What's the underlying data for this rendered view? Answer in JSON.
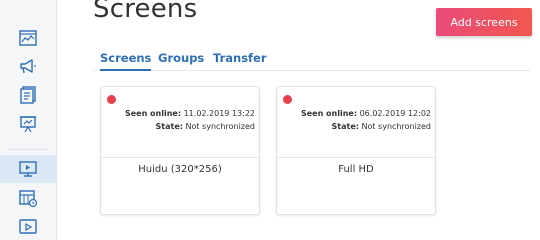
{
  "page": {
    "title": "Screens",
    "add_button_label": "Add screens"
  },
  "tabs": [
    {
      "label": "Screens",
      "active": true
    },
    {
      "label": "Groups",
      "active": false
    },
    {
      "label": "Transfer",
      "active": false
    }
  ],
  "sidebar": {
    "items": [
      {
        "icon": "dashboard-chart-icon",
        "active": false
      },
      {
        "icon": "megaphone-icon",
        "active": false
      },
      {
        "icon": "content-pages-icon",
        "active": false
      },
      {
        "icon": "presentation-board-icon",
        "active": false
      },
      {
        "icon": "monitor-screen-icon",
        "active": true
      },
      {
        "icon": "calendar-schedule-icon",
        "active": false
      },
      {
        "icon": "video-player-icon",
        "active": false
      }
    ]
  },
  "labels": {
    "seen_online": "Seen online:",
    "state": "State:"
  },
  "cards": [
    {
      "name": "Huidu (320*256)",
      "seen_online": "11.02.2019 13:22",
      "state": "Not synchronized",
      "status_color": "#e5414f"
    },
    {
      "name": "Full HD",
      "seen_online": "06.02.2019 12:02",
      "state": "Not synchronized",
      "status_color": "#e5414f"
    }
  ],
  "colors": {
    "accent": "#2f6fb7",
    "button_gradient_start": "#ea4b7a",
    "button_gradient_end": "#f2574e"
  }
}
